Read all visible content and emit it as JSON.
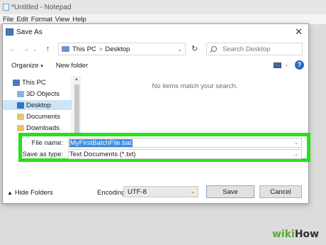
{
  "notepad": {
    "title": "*Untitled - Notepad",
    "menu": [
      "File",
      "Edit",
      "Format",
      "View",
      "Help"
    ]
  },
  "dialog": {
    "title": "Save As",
    "close_label": "✕",
    "nav": {
      "back": "←",
      "forward": "→",
      "dropdown": "⌄",
      "up": "↑",
      "breadcrumb": [
        "This PC",
        "Desktop"
      ],
      "breadcrumb_sep": ">",
      "refresh": "↻",
      "search_placeholder": "Search Desktop"
    },
    "toolbar": {
      "organize": "Organize",
      "organize_caret": "▾",
      "new_folder": "New folder",
      "help": "?"
    },
    "tree": [
      {
        "label": "This PC",
        "icon": "computer-icon",
        "color": "#4b79b8"
      },
      {
        "label": "3D Objects",
        "icon": "3d-objects-icon",
        "color": "#7fb4e6"
      },
      {
        "label": "Desktop",
        "icon": "desktop-icon",
        "color": "#2d76c7",
        "selected": true
      },
      {
        "label": "Documents",
        "icon": "documents-icon",
        "color": "#e8c46a"
      },
      {
        "label": "Downloads",
        "icon": "downloads-icon",
        "color": "#e8c46a"
      }
    ],
    "empty_message": "No items match your search.",
    "file_name_label": "File name:",
    "file_name_value": "MyFirstBatchFile.bat",
    "save_type_label": "Save as type:",
    "save_type_value": "Text Documents (*.txt)",
    "hide_folders": "Hide Folders",
    "encoding_label": "Encoding:",
    "encoding_value": "UTF-8",
    "save_button": "Save",
    "cancel_button": "Cancel"
  },
  "highlight_color": "#26e01a",
  "selection_color": "#3a8dde",
  "watermark": {
    "part1": "wiki",
    "part2": "How"
  }
}
